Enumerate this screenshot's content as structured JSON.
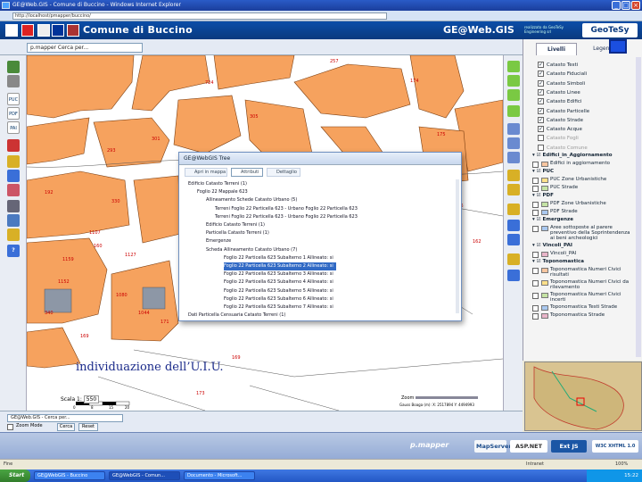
{
  "browser": {
    "title": "GE@Web.GIS - Comune di Buccino - Windows Internet Explorer",
    "address": "http://localhost/pmapper/buccino/"
  },
  "app": {
    "title": "Comune di Buccino",
    "product": "GE@Web.GIS",
    "product_sub": "realizzato da GeoTeSy Engineering srl",
    "brand": "GeoTeSy"
  },
  "toolbar": {
    "mapper_select": "p.mapper   Cerca per...",
    "search_select": "GE@Web.GIS - Cerca per..."
  },
  "panel": {
    "tabs": [
      "Livelli",
      "Legenda"
    ],
    "layers": [
      {
        "label": "Catasto Testi",
        "checked": true
      },
      {
        "label": "Catasto Fiduciali",
        "checked": true
      },
      {
        "label": "Catasto Simboli",
        "checked": true
      },
      {
        "label": "Catasto Linee",
        "checked": true
      },
      {
        "label": "Catasto Edifici",
        "checked": true
      },
      {
        "label": "Catasto Particelle",
        "checked": true
      },
      {
        "label": "Catasto Strade",
        "checked": true
      },
      {
        "label": "Catasto Acque",
        "checked": true
      },
      {
        "label": "Catasto Fogli",
        "checked": false
      },
      {
        "label": "Catasto Comune",
        "checked": false
      }
    ],
    "groups": [
      {
        "title": "Edifici_in_Aggiornamento",
        "items": [
          "Edifici in aggiornamento"
        ]
      },
      {
        "title": "PUC",
        "items": [
          "PUC Zone Urbanistiche",
          "PUC Strade"
        ]
      },
      {
        "title": "PDF",
        "items": [
          "PDF Zone Urbanistiche",
          "PDF Strade"
        ]
      },
      {
        "title": "Emergenze",
        "items": [
          "Aree sottoposte al parere preventivo della Soprintendenza ai beni archeologici"
        ]
      },
      {
        "title": "Vincoli_PAI",
        "items": [
          "Vincoli_PAI"
        ]
      },
      {
        "title": "Toponomastica",
        "items": [
          "Toponomastica Numeri Civici risultati",
          "Toponomastica Numeri Civici da rilevamento",
          "Toponomastica Numeri Civici incerti",
          "Toponomastica Testi Strade",
          "Toponomastica Strade"
        ]
      }
    ]
  },
  "dialog": {
    "title": "GE@WebGIS Tree",
    "buttons": [
      "Apri in mappa",
      "Attributi",
      "Dettaglio"
    ],
    "rows": [
      {
        "text": "Edificio Catasto Terreni (1)",
        "indent": 0,
        "selected": false
      },
      {
        "text": "Foglio 22 Mappale 623",
        "indent": 1,
        "selected": false
      },
      {
        "text": "Allineamento Schede Catasto Urbano (5)",
        "indent": 2,
        "selected": false
      },
      {
        "text": "Terreni Foglio 22 Particella 623 - Urbano Foglio 22 Particella 623",
        "indent": 3,
        "selected": false
      },
      {
        "text": "Terreni Foglio 22 Particella 623 - Urbano Foglio 22 Particella 623",
        "indent": 3,
        "selected": false
      },
      {
        "text": "Edificio Catasto Terreni (1)",
        "indent": 2,
        "selected": false
      },
      {
        "text": "Particella Catasto Terreni (1)",
        "indent": 2,
        "selected": false
      },
      {
        "text": "Emergenze",
        "indent": 2,
        "selected": false
      },
      {
        "text": "Scheda Allineamento Catasto Urbano (7)",
        "indent": 2,
        "selected": false
      },
      {
        "text": "Foglio 22 Particella 623 Subalterno 1 Allineato: si",
        "indent": 4,
        "selected": false
      },
      {
        "text": "Foglio 22 Particella 623 Subalterno 2 Allineato: si",
        "indent": 4,
        "selected": true
      },
      {
        "text": "Foglio 22 Particella 623 Subalterno 3 Allineato: si",
        "indent": 4,
        "selected": false
      },
      {
        "text": "Foglio 22 Particella 623 Subalterno 4 Allineato: si",
        "indent": 4,
        "selected": false
      },
      {
        "text": "Foglio 22 Particella 623 Subalterno 5 Allineato: si",
        "indent": 4,
        "selected": false
      },
      {
        "text": "Foglio 22 Particella 623 Subalterno 6 Allineato: si",
        "indent": 4,
        "selected": false
      },
      {
        "text": "Foglio 22 Particella 623 Subalterno 7 Allineato: si",
        "indent": 4,
        "selected": false
      },
      {
        "text": "Dati Particella Censuaria Catasto Terreni (1)",
        "indent": 0,
        "selected": false
      }
    ]
  },
  "map": {
    "caption": "individuazione dell’U.I.U.",
    "parcel_labels": [
      "257",
      "174",
      "171",
      "169",
      "173",
      "169",
      "183",
      "162",
      "340",
      "330",
      "724",
      "180",
      "186",
      "195",
      "214",
      "221",
      "293",
      "301",
      "305",
      "175",
      "192",
      "160",
      "1159",
      "1080",
      "1107",
      "1127",
      "1152",
      "1044"
    ],
    "scale_label": "Scala 1:",
    "scale_value": "550",
    "scale_ticks": [
      "0",
      "8",
      "15",
      "20"
    ],
    "zoom_label": "Zoom",
    "coords": "Gauss Boaga (m): X: 2517894  Y: 4494993"
  },
  "bottom": {
    "zoom_mode": "Zoom Mode",
    "cerca": "Cerca",
    "reset": "Reset"
  },
  "footer": {
    "pmapper": "p.mapper",
    "logos": [
      "MapServer",
      "ASP.NET",
      "Ext JS",
      "W3C XHTML 1.0"
    ]
  },
  "status": {
    "left": "Fine",
    "zone": "Intranet",
    "zoom": "100%"
  },
  "taskbar": {
    "start": "Start",
    "tasks": [
      "GE@WebGIS - Buccino",
      "GE@WebGIS - Comun...",
      "Documento - Microsoft..."
    ],
    "clock": "15:22"
  }
}
